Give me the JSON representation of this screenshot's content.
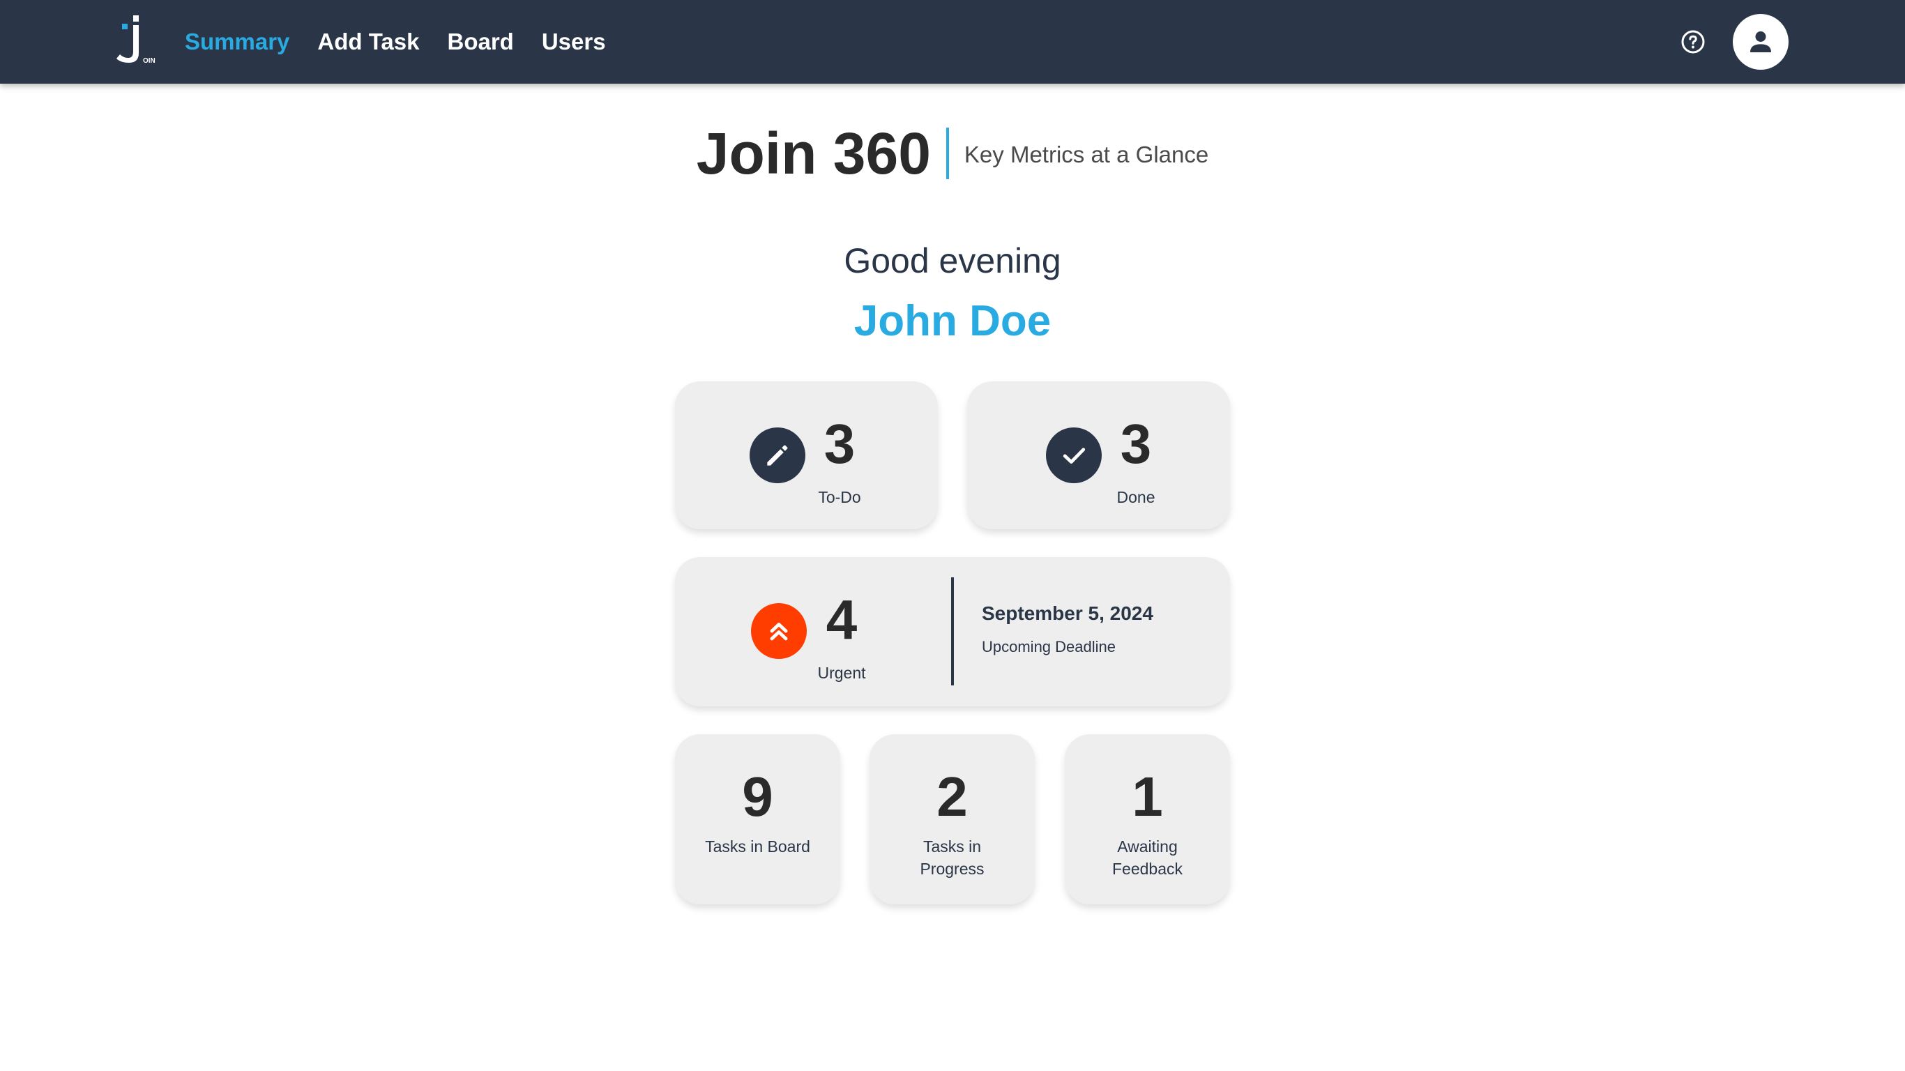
{
  "header": {
    "logo_letter": "J",
    "logo_small_text": "OIN",
    "nav": {
      "summary": "Summary",
      "add_task": "Add Task",
      "board": "Board",
      "users": "Users"
    },
    "help_icon": "help-circle-icon",
    "avatar_icon": "person-icon"
  },
  "title": {
    "main": "Join 360",
    "subtitle": "Key Metrics at a Glance"
  },
  "greeting": {
    "text": "Good evening",
    "name": "John Doe"
  },
  "metrics": {
    "todo": {
      "count": "3",
      "label": "To-Do",
      "icon": "pencil-icon"
    },
    "done": {
      "count": "3",
      "label": "Done",
      "icon": "check-icon"
    },
    "urgent": {
      "count": "4",
      "label": "Urgent",
      "icon": "double-chevron-up-icon"
    },
    "deadline": {
      "date": "September 5, 2024",
      "label": "Upcoming Deadline"
    },
    "board": {
      "count": "9",
      "label": "Tasks in Board"
    },
    "progress": {
      "count": "2",
      "label": "Tasks in Progress"
    },
    "feedback": {
      "count": "1",
      "label": "Awaiting Feedback"
    }
  },
  "colors": {
    "header_bg": "#2a3647",
    "accent": "#29abe2",
    "urgent": "#ff3d00",
    "card_bg": "#eeeeee"
  }
}
